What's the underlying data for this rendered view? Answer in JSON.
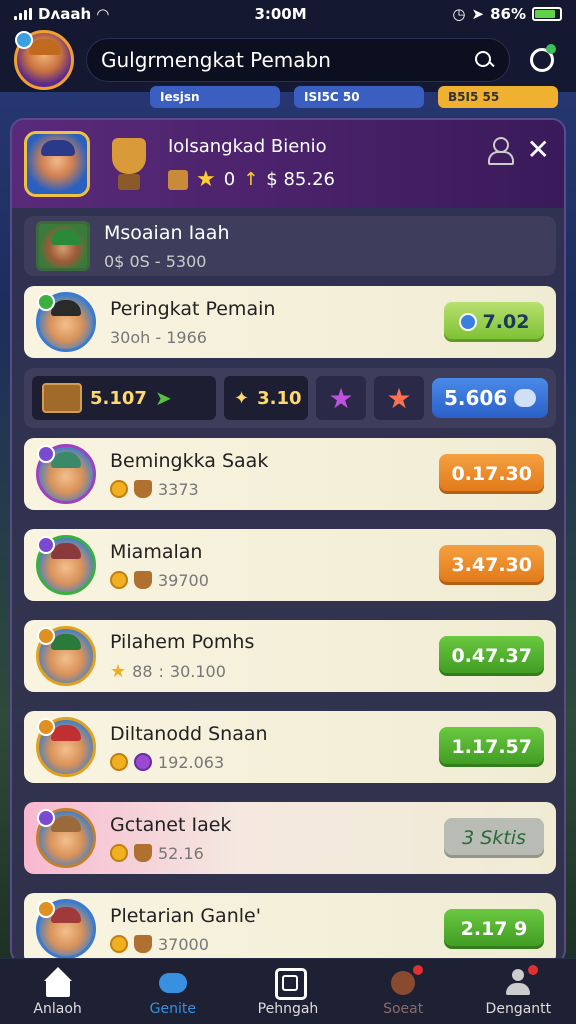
{
  "status_bar": {
    "carrier": "Dᴧaah",
    "time": "3:00M",
    "battery": "86%",
    "battery_level": 0.78
  },
  "header": {
    "search_text": "Gulgrmengkat Pemabn"
  },
  "top_pills": [
    "Iesjsn",
    "ISI5C 50",
    "B5I5 55"
  ],
  "panel": {
    "title": "Iolsangkad Bienio",
    "stat_a": "0",
    "stat_b": "$ 85.26"
  },
  "banner_row": {
    "name": "Msoaian Iaah",
    "sub": "0$ 0S - 5300"
  },
  "player_row": {
    "name": "Peringkat Pemain",
    "sub": "30oh - 1966",
    "score": "7.02"
  },
  "stats_strip": {
    "chest_value": "5.107",
    "star_value": "3.10",
    "blue_value": "5.606"
  },
  "rows": [
    {
      "name": "Bemingkka Saak",
      "sub": "3373",
      "score": "0.17.30"
    },
    {
      "name": "Miamalan",
      "sub": "39700",
      "score": "3.47.30"
    },
    {
      "name": "Pilahem Pomhs",
      "sub_prefix": "88",
      "sub": "30.100",
      "score": "0.47.37"
    },
    {
      "name": "Diltanodd Snaan",
      "sub": "192.063",
      "score": "1.17.57"
    },
    {
      "name": "Gctanet Iaek",
      "sub": "52.16",
      "score": "3 Sktis"
    },
    {
      "name": "Pletarian Ganle'",
      "sub": "37000",
      "score": "2.17 9"
    }
  ],
  "bottom_nav": [
    {
      "label": "Anlaoh",
      "icon": "home-icon"
    },
    {
      "label": "Genite",
      "icon": "game-icon"
    },
    {
      "label": "Pehngah",
      "icon": "ranking-icon"
    },
    {
      "label": "Soeat",
      "icon": "shop-icon"
    },
    {
      "label": "Dengantt",
      "icon": "profile-icon"
    }
  ],
  "colors": {
    "accent_green": "#3f9a22",
    "accent_orange": "#e07818",
    "accent_blue": "#2a60c8"
  }
}
